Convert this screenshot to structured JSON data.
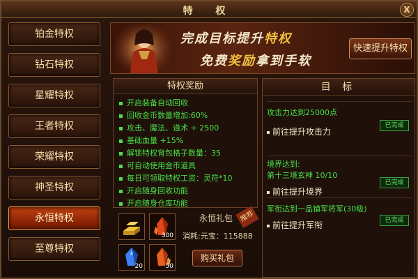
{
  "window": {
    "title": "特 权",
    "close_label": "X"
  },
  "sidebar": {
    "items": [
      {
        "label": "铂金特权",
        "active": false
      },
      {
        "label": "钻石特权",
        "active": false
      },
      {
        "label": "星耀特权",
        "active": false
      },
      {
        "label": "王者特权",
        "active": false
      },
      {
        "label": "荣耀特权",
        "active": false
      },
      {
        "label": "神圣特权",
        "active": false
      },
      {
        "label": "永恒特权",
        "active": true
      },
      {
        "label": "至尊特权",
        "active": false
      }
    ]
  },
  "banner": {
    "line1_prefix": "完成目标提升",
    "line1_highlight": "特权",
    "line2_prefix": "免费",
    "line2_highlight": "奖励",
    "line2_suffix": "拿到手软",
    "quick_button": "快速提升特权"
  },
  "rewards": {
    "title": "特权奖励",
    "items": [
      "开启装备自动回收",
      "回收金币数量增加:60%",
      "攻击、魔法、道术 + 2500",
      "基础血量 +15%",
      "解锁特权背包格子数量：35",
      "可自动使用金币道具",
      "每日可领取特权工资：灵符*10",
      "开启随身回收功能",
      "开启随身仓库功能"
    ]
  },
  "gift": {
    "name": "永恒礼包",
    "tag": "推荐",
    "cost": "消耗:元宝：115888",
    "buy_button": "购买礼包",
    "slots": [
      {
        "icon": "gold-bars-icon",
        "count": ""
      },
      {
        "icon": "red-crystal-icon",
        "count": "300"
      },
      {
        "icon": "blue-crystal-icon",
        "count": "20"
      },
      {
        "icon": "orange-crystal-icon",
        "count": "50"
      }
    ]
  },
  "goals": {
    "title": "目 标",
    "cards": [
      {
        "condition": "攻击力达到25000点",
        "condition2": "",
        "action": "前往提升攻击力",
        "status": "已完成"
      },
      {
        "condition": "境界达到:",
        "condition2": "第十三境玄神 10/10",
        "action": "前往提升境界",
        "status": "已完成"
      },
      {
        "condition": "军衔达到一品镇军将军(30级)",
        "condition2": "",
        "action": "前往提升军衔",
        "status": "已完成"
      }
    ]
  },
  "colors": {
    "accent": "#f0c040",
    "status_green": "#48e048",
    "active_tab": "#c04010"
  }
}
